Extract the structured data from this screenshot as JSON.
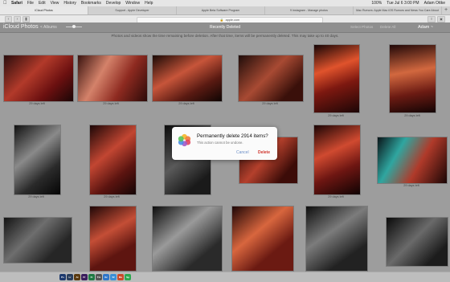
{
  "menubar": {
    "apple_icon": "apple-icon",
    "menus": [
      "Safari",
      "File",
      "Edit",
      "View",
      "History",
      "Bookmarks",
      "Develop",
      "Window",
      "Help"
    ],
    "battery": "100%",
    "clock": "Tue Jul 6  3:00 PM",
    "user": "Adam Ottke"
  },
  "tabs": [
    {
      "label": "iCloud Photos",
      "active": true
    },
    {
      "label": "Support - Apple Developer",
      "active": false
    },
    {
      "label": "Apple Beta Software Program",
      "active": false
    },
    {
      "label": "9 Instagram  - Manage photos",
      "active": false
    },
    {
      "label": "Mac Rumors: Apple Mac iOS Rumors and News You Care About",
      "active": false
    }
  ],
  "address": {
    "url": "apple.com",
    "lock_icon": "lock-icon"
  },
  "app": {
    "brand": "iCloud",
    "product": "Photos",
    "albums_label": "< Albums",
    "title": "Recently Deleted",
    "select_label": "Select Photos",
    "delete_all_label": "Delete All",
    "user_menu": "Adam ~"
  },
  "notice": "Photos and videos show the time remaining before deletion. After that time, items will be permanently deleted. This may take up to 40 days.",
  "photos": [
    {
      "caption": "29 days left"
    },
    {
      "caption": "29 days left"
    },
    {
      "caption": "29 days left"
    },
    {
      "caption": "29 days left"
    },
    {
      "caption": "29 days left"
    },
    {
      "caption": "29 days left"
    },
    {
      "caption": "29 days left"
    },
    {
      "caption": "29 days left"
    },
    {
      "caption": "29 days left"
    },
    {
      "caption": "29 days left"
    },
    {
      "caption": "29 days left"
    },
    {
      "caption": "29 days left"
    },
    {
      "caption": "29 days left"
    }
  ],
  "dialog": {
    "title": "Permanently delete 2914 items?",
    "subtitle": "This action cannot be undone.",
    "cancel_label": "Cancel",
    "delete_label": "Delete",
    "icon": "photos-app-icon"
  },
  "dock": {
    "apps": [
      "Ps",
      "Lr",
      "Ai",
      "Pr",
      "Fi",
      "Tm",
      "Xc",
      "Sf",
      "Ms",
      "Sp"
    ]
  },
  "colors": {
    "accent": "#6b8ec7",
    "danger": "#d0342c",
    "overlay": "#9d9d9d"
  }
}
